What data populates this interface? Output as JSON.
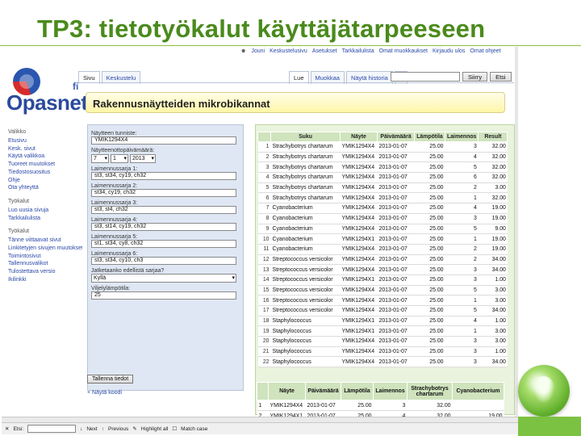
{
  "slide_title": "TP3: tietotyökalut käyttäjätarpeeseen",
  "top_links": [
    "Jouni",
    "Keskustelusivu",
    "Asetukset",
    "Tarkkailulista",
    "Omat muokkaukset",
    "Kirjaudu ulos",
    "Omat ohjeet"
  ],
  "logo": {
    "text": "Opasnet",
    "suffix": "fi"
  },
  "tabs_left": [
    "Sivu",
    "Keskustelu"
  ],
  "tabs_right": [
    "Lue",
    "Muokkaa",
    "Näytä historia"
  ],
  "search": {
    "go": "Siirry",
    "find": "Etsi"
  },
  "page_heading": "Rakennusnäytteiden mikrobikannat",
  "sidebar": {
    "sections": [
      {
        "heading": "Valikko",
        "links": [
          "Etusivu",
          "Kesk. sivut",
          "Käytä valikkoa",
          "Tuoreet muutokset",
          "Tiedostosuositus",
          "Ohje",
          "Ota yhteyttä"
        ]
      },
      {
        "heading": "Työkalut",
        "links": [
          "Luo uusia sivuja",
          "Tarkkailulista"
        ]
      },
      {
        "heading": "Työkalut",
        "links": [
          "Tänne viittaavat sivut",
          "Linkitetyjen sivujen muutokset",
          "Toimintosivut",
          "Tallennusvalikot",
          "Tulostettava versio",
          "Ikilinkki"
        ]
      }
    ]
  },
  "form": {
    "fields": [
      {
        "label": "Näytteen tunniste:",
        "value": "YMIK1294X4"
      },
      {
        "label": "Laimennussarja 1:",
        "value": "st3, st34, cy19, ch32"
      },
      {
        "label": "Laimennussarja 2:",
        "value": "st34, cy19, ch32"
      },
      {
        "label": "Laimennussarja 3:",
        "value": "st3, st4, ch32"
      },
      {
        "label": "Laimennussarja 4:",
        "value": "st3, st14, cy19, ch32"
      },
      {
        "label": "Laimennussarja 5:",
        "value": "st1, st34, cy8, ch32"
      },
      {
        "label": "Laimennussarja 6:",
        "value": "st3, st34, cy10, ch3"
      }
    ],
    "date_label": "Näytteenottopäivämäärä:",
    "date": {
      "day": "7",
      "month": "1",
      "year": "2013"
    },
    "dilution_label": "Jatketaanko edellistä sarjaa?",
    "dilution_value": "Kyllä",
    "temp_label": "Viljelylämpötila:",
    "temp_value": "25",
    "submit": "Tallenna tiedot",
    "add_link": "+ Näytä koodi"
  },
  "results": {
    "columns": [
      "Suku",
      "Näyte",
      "Päivämäärä",
      "Lämpötila",
      "Laimennos",
      "Result"
    ],
    "rows": [
      [
        "1",
        "Strachybotrys chartarum",
        "YMIK1294X4",
        "2013-01-07",
        "25.00",
        "3",
        "32.00"
      ],
      [
        "2",
        "Strachybotrys chartarum",
        "YMIK1294X4",
        "2013-01-07",
        "25.00",
        "4",
        "32.00"
      ],
      [
        "3",
        "Strachybotrys chartarum",
        "YMIK1294X4",
        "2013-01-07",
        "25.00",
        "5",
        "32.00"
      ],
      [
        "4",
        "Strachybotrys chartarum",
        "YMIK1294X4",
        "2013-01-07",
        "25.00",
        "6",
        "32.00"
      ],
      [
        "5",
        "Strachybotrys chartarum",
        "YMIK1294X4",
        "2013-01-07",
        "25.00",
        "2",
        "3.00"
      ],
      [
        "6",
        "Strachybotrys chartarum",
        "YMIK1294X4",
        "2013-01-07",
        "25.00",
        "1",
        "32.00"
      ],
      [
        "7",
        "Cyanobacterium",
        "YMIK1294X4",
        "2013-01-07",
        "25.00",
        "4",
        "19.00"
      ],
      [
        "8",
        "Cyanobacterium",
        "YMIK1294X4",
        "2013-01-07",
        "25.00",
        "3",
        "19.00"
      ],
      [
        "9",
        "Cyanobacterium",
        "YMIK1294X4",
        "2013-01-07",
        "25.00",
        "5",
        "9.00"
      ],
      [
        "10",
        "Cyanobacterium",
        "YMIK1294X1",
        "2013-01-07",
        "25.00",
        "1",
        "19.00"
      ],
      [
        "11",
        "Cyanobacterium",
        "YMIK1294X4",
        "2013-01-07",
        "25.00",
        "2",
        "19.00"
      ],
      [
        "12",
        "Streptococcus versicolor",
        "YMIK1294X4",
        "2013-01-07",
        "25.00",
        "2",
        "34.00"
      ],
      [
        "13",
        "Streptococcus versicolor",
        "YMIK1294X4",
        "2013-01-07",
        "25.00",
        "3",
        "34.00"
      ],
      [
        "14",
        "Streptococcus versicolor",
        "YMIK1294X1",
        "2013-01-07",
        "25.00",
        "3",
        "1.00"
      ],
      [
        "15",
        "Streptococcus versicolor",
        "YMIK1294X4",
        "2013-01-07",
        "25.00",
        "5",
        "3.00"
      ],
      [
        "16",
        "Streptococcus versicolor",
        "YMIK1294X4",
        "2013-01-07",
        "25.00",
        "1",
        "3.00"
      ],
      [
        "17",
        "Streptococcus versicolor",
        "YMIK1294X4",
        "2013-01-07",
        "25.00",
        "5",
        "34.00"
      ],
      [
        "18",
        "Staphylococcus",
        "YMIK1294X1",
        "2013-01-07",
        "25.00",
        "4",
        "1.00"
      ],
      [
        "19",
        "Staphylococcus",
        "YMIK1294X1",
        "2013-01-07",
        "25.00",
        "1",
        "3.00"
      ],
      [
        "20",
        "Staphylococcus",
        "YMIK1294X4",
        "2013-01-07",
        "25.00",
        "3",
        "3.00"
      ],
      [
        "21",
        "Staphylococcus",
        "YMIK1294X4",
        "2013-01-07",
        "25.00",
        "3",
        "1.00"
      ],
      [
        "22",
        "Staphylococcus",
        "YMIK1294X4",
        "2013-01-07",
        "25.00",
        "3",
        "34.00"
      ]
    ]
  },
  "pivot": {
    "columns": [
      "Näyte",
      "Päivämäärä",
      "Lämpötila",
      "Laimennos",
      "Strachybotrys chartarum",
      "Cyanobacterium"
    ],
    "rows": [
      [
        "1",
        "YMIK1294X4",
        "2013-01-07",
        "25.00",
        "3",
        "32.00",
        ""
      ],
      [
        "2",
        "YMIK1294X1",
        "2013-01-07",
        "25.00",
        "4",
        "32.00",
        "19.00"
      ]
    ]
  },
  "findbar": {
    "find": "Etsi:",
    "next": "Next",
    "previous": "Previous",
    "highlight": "Highlight all",
    "match_case": "Match case"
  }
}
